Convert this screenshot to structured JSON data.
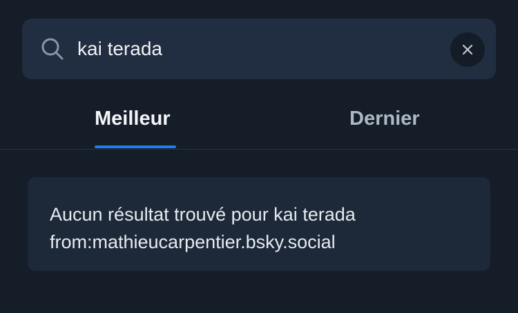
{
  "search": {
    "value": "kai terada",
    "icon": "search-icon",
    "clear_icon": "close-icon"
  },
  "tabs": [
    {
      "label": "Meilleur",
      "active": true
    },
    {
      "label": "Dernier",
      "active": false
    }
  ],
  "results": {
    "empty_message": "Aucun résultat trouvé pour kai terada from:mathieucarpentier.bsky.social"
  },
  "colors": {
    "background": "#151d28",
    "search_bg": "#212d40",
    "card_bg": "#1d2838",
    "accent": "#1f7ef0",
    "text_primary": "#f3f5f8",
    "text_muted": "#aeb7c4"
  }
}
